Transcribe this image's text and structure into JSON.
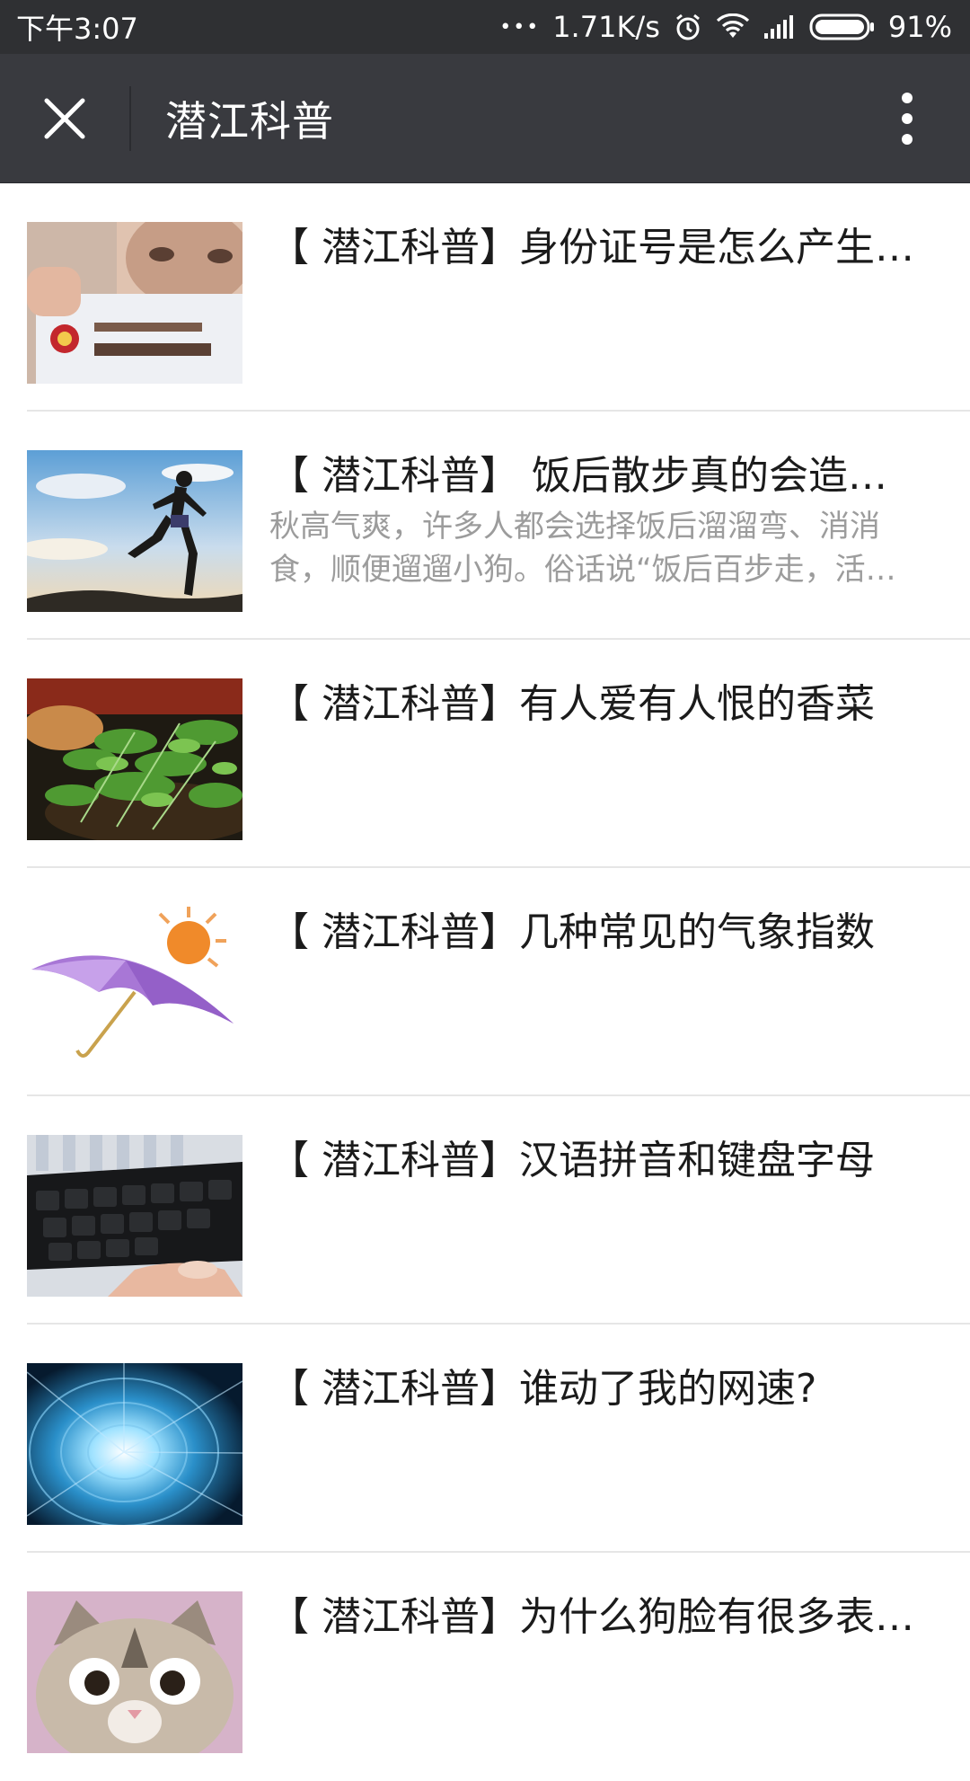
{
  "status_bar": {
    "time": "下午3:07",
    "dots": "•••",
    "network_speed": "1.71K/s",
    "battery_percent": "91%",
    "icons": [
      "alarm-icon",
      "wifi-icon",
      "signal-icon",
      "battery-icon"
    ]
  },
  "app_bar": {
    "title": "潜江科普",
    "close_icon": "close-icon",
    "more_icon": "more-vert-icon"
  },
  "articles": [
    {
      "title": "【 潜江科普】身份证号是怎么产生的？",
      "desc": "",
      "thumb": "id-card"
    },
    {
      "title": "【 潜江科普】 饭后散步真的会造成胃下垂吗？",
      "desc": "秋高气爽，许多人都会选择饭后溜溜弯、消消食，顺便遛遛小狗。俗话说“饭后百步走，活到九十九”",
      "thumb": "runner"
    },
    {
      "title": "【 潜江科普】有人爱有人恨的香菜",
      "desc": "",
      "thumb": "cilantro"
    },
    {
      "title": "【 潜江科普】几种常见的气象指数",
      "desc": "",
      "thumb": "umbrella"
    },
    {
      "title": "【 潜江科普】汉语拼音和键盘字母",
      "desc": "",
      "thumb": "keyboard"
    },
    {
      "title": "【 潜江科普】谁动了我的网速?",
      "desc": "",
      "thumb": "data-tunnel"
    },
    {
      "title": "【 潜江科普】为什么狗脸有很多表情？",
      "desc": "",
      "thumb": "cat"
    }
  ],
  "colors": {
    "status_bar_bg": "#2f3033",
    "app_bar_bg": "#393a3f",
    "title_text": "#1b1b1b",
    "desc_text": "#9c9c9c",
    "divider": "#e6e6e6"
  }
}
